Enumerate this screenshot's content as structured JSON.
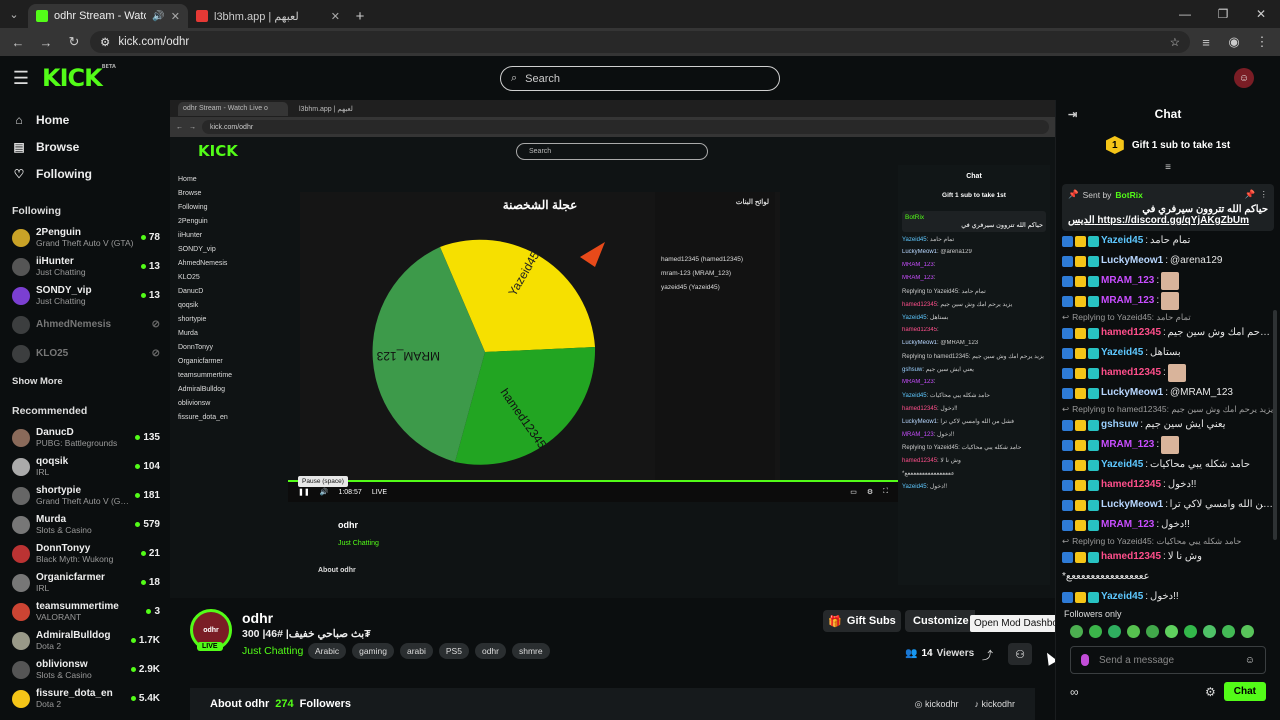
{
  "browser": {
    "tabs": [
      {
        "title": "odhr Stream - Watch Live o",
        "active": true,
        "favicon_color": "#53fc18"
      },
      {
        "title": "l3bhm.app | لعبهم",
        "active": false,
        "favicon_color": "#e53935"
      }
    ],
    "address": "kick.com/odhr"
  },
  "header": {
    "logo": "KICK",
    "logo_tag": "BETA",
    "search_placeholder": "Search"
  },
  "sidebar": {
    "nav": [
      {
        "label": "Home",
        "icon": "home-icon"
      },
      {
        "label": "Browse",
        "icon": "browse-icon"
      },
      {
        "label": "Following",
        "icon": "heart-icon"
      }
    ],
    "following_title": "Following",
    "following": [
      {
        "name": "2Penguin",
        "category": "Grand Theft Auto V (GTA)",
        "viewers": "78",
        "color": "#c9a227"
      },
      {
        "name": "iiHunter",
        "category": "Just Chatting",
        "viewers": "13",
        "color": "#555"
      },
      {
        "name": "SONDY_vip",
        "category": "Just Chatting",
        "viewers": "13",
        "color": "#7b3fd1"
      },
      {
        "name": "AhmedNemesis",
        "category": "",
        "viewers": "",
        "color": "#888"
      },
      {
        "name": "KLO25",
        "category": "",
        "viewers": "",
        "color": "#888"
      }
    ],
    "show_more": "Show More",
    "recommended_title": "Recommended",
    "recommended": [
      {
        "name": "DanucD",
        "category": "PUBG: Battlegrounds",
        "viewers": "135",
        "color": "#8a6a5a"
      },
      {
        "name": "qoqsik",
        "category": "IRL",
        "viewers": "104",
        "color": "#aaa"
      },
      {
        "name": "shortypie",
        "category": "Grand Theft Auto V (GT...",
        "viewers": "181",
        "color": "#666"
      },
      {
        "name": "Murda",
        "category": "Slots & Casino",
        "viewers": "579",
        "color": "#777"
      },
      {
        "name": "DonnTonyy",
        "category": "Black Myth: Wukong",
        "viewers": "21",
        "color": "#b33"
      },
      {
        "name": "Organicfarmer",
        "category": "IRL",
        "viewers": "18",
        "color": "#777"
      },
      {
        "name": "teamsummertime",
        "category": "VALORANT",
        "viewers": "3",
        "color": "#c43"
      },
      {
        "name": "AdmiralBulldog",
        "category": "Dota 2",
        "viewers": "1.7K",
        "color": "#998"
      },
      {
        "name": "oblivionsw",
        "category": "Slots & Casino",
        "viewers": "2.9K",
        "color": "#555"
      },
      {
        "name": "fissure_dota_en",
        "category": "Dota 2",
        "viewers": "5.4K",
        "color": "#f5c518"
      }
    ]
  },
  "player": {
    "wheel_title": "عجلة الشخصنة",
    "wheel_segments": [
      "Yazeid45",
      "hamed12345",
      "MRAM_123"
    ],
    "time": "1:08:57",
    "live": "LIVE",
    "pause_tooltip": "Pause (space)",
    "stats_title": "لوائح البنات",
    "stats_lines": [
      "hamed12345 (hamed12345)",
      "mram-123 (MRAM_123)",
      "yazeid45 (Yazeid45)"
    ]
  },
  "stream": {
    "name": "odhr",
    "title": "بث صباحي خفيف| #46| 300₮",
    "category": "Just Chatting",
    "tags": [
      "Arabic",
      "gaming",
      "arabi",
      "PS5",
      "odhr",
      "shmre"
    ],
    "gift_label": "Gift Subs",
    "customize_label": "Customize channel",
    "mod_tooltip": "Open Mod Dashboard",
    "viewers_count": "14",
    "viewers_label": "Viewers",
    "live_badge": "LIVE",
    "about_label": "About odhr",
    "followers_count": "274",
    "followers_label": "Followers",
    "socials": [
      "kickodhr",
      "kickodhr"
    ]
  },
  "chat": {
    "title": "Chat",
    "gift_label": "Gift 1 sub to take 1st",
    "gift_rank": "1",
    "pinned_sent_by": "Sent by",
    "pinned_user": "BotRix",
    "pinned_text": "حياكم الله تتروون سيرفري في",
    "pinned_link": "الديس https://discord.gg/qYjAKgZbUm",
    "messages": [
      {
        "type": "msg",
        "user": "Yazeid45",
        "color": "#5ec8ff",
        "text": "تمام حامد"
      },
      {
        "type": "msg",
        "user": "LuckyMeow1",
        "color": "#b8d7ff",
        "text": "@arena129"
      },
      {
        "type": "msg",
        "user": "MRAM_123",
        "color": "#c84dff",
        "text": "",
        "emote": true
      },
      {
        "type": "msg",
        "user": "MRAM_123",
        "color": "#c84dff",
        "text": "",
        "emote": true
      },
      {
        "type": "reply",
        "text": "Replying to Yazeid45: تمام حامد"
      },
      {
        "type": "msg",
        "user": "hamed12345",
        "color": "#ff4f8b",
        "text": "يزيد يرحم امك وش سين جيم"
      },
      {
        "type": "msg",
        "user": "Yazeid45",
        "color": "#5ec8ff",
        "text": "بستاهل"
      },
      {
        "type": "msg",
        "user": "hamed12345",
        "color": "#ff4f8b",
        "text": "",
        "emote": true
      },
      {
        "type": "msg",
        "user": "LuckyMeow1",
        "color": "#b8d7ff",
        "text": "@MRAM_123"
      },
      {
        "type": "reply",
        "text": "Replying to hamed12345: يزيد يرحم امك وش سين جيم"
      },
      {
        "type": "msg",
        "user": "gshsuw",
        "color": "#9bd0ff",
        "text": "يعني ايش سين جيم"
      },
      {
        "type": "msg",
        "user": "MRAM_123",
        "color": "#c84dff",
        "text": "",
        "emote": true
      },
      {
        "type": "msg",
        "user": "Yazeid45",
        "color": "#5ec8ff",
        "text": "حامد شكله يبي محاكيات"
      },
      {
        "type": "msg",
        "user": "hamed12345",
        "color": "#ff4f8b",
        "text": "دخول!!"
      },
      {
        "type": "msg",
        "user": "LuckyMeow1",
        "color": "#b8d7ff",
        "text": "فشل من الله وامسي لاكي ترا"
      },
      {
        "type": "msg",
        "user": "MRAM_123",
        "color": "#c84dff",
        "text": "دخول!!"
      },
      {
        "type": "reply",
        "text": "Replying to Yazeid45: حامد شكله يبي محاكيات"
      },
      {
        "type": "msg",
        "user": "hamed12345",
        "color": "#ff4f8b",
        "text": "وش نا لا"
      },
      {
        "type": "plain",
        "text": "*ععععععععععععععععع"
      },
      {
        "type": "msg",
        "user": "Yazeid45",
        "color": "#5ec8ff",
        "text": "دخول!!"
      }
    ],
    "followers_only": "Followers only",
    "send_placeholder": "Send a message",
    "chat_button": "Chat"
  }
}
